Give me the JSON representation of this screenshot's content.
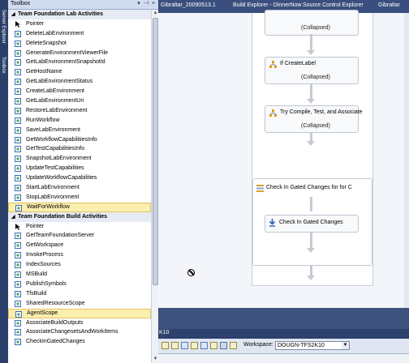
{
  "left_strip": {
    "server_explorer": "Server Explorer",
    "toolbox": "Toolbox"
  },
  "toolbox": {
    "title": "Toolbox",
    "sections": [
      {
        "title": "Team Foundation Lab Activities",
        "items": [
          "Pointer",
          "DeleteLabEnvironment",
          "DeleteSnapshot",
          "GenerateEnvironmentViewerFile",
          "GetLabEnvironmentSnapshotId",
          "GetHostName",
          "GetLabEnvironmentStatus",
          "CreateLabEnvironment",
          "GetLabEnvironmentUri",
          "RestoreLabEnvironment",
          "RunWorkflow",
          "SaveLabEnvironment",
          "GetWorkflowCapabilitiesInfo",
          "GetTestCapabilitiesInfo",
          "SnapshotLabEnvironment",
          "UpdateTestCapabilities",
          "UpdateWorkflowCapabilities",
          "StartLabEnvironment",
          "StopLabEnvironment",
          "WaitForWorkflow"
        ]
      },
      {
        "title": "Team Foundation Build Activities",
        "items": [
          "Pointer",
          "GetTeamFoundationServer",
          "GetWorkspace",
          "InvokeProcess",
          "IndexSources",
          "MSBuild",
          "PublishSymbols",
          "TfsBuild",
          "SharedResourceScope",
          "AgentScope",
          "AssociateBuildOutputs",
          "AssociateChangesetsAndWorkItems",
          "CheckInGatedChanges"
        ]
      }
    ]
  },
  "tabs": [
    "Gibraltar_20090513.1",
    "Build Explorer - DinnerNow",
    "Source Control Explorer",
    "Gibraltar"
  ],
  "designer": {
    "collapsed": "(Collapsed)",
    "activities": [
      "If CreateLabel",
      "Try Compile, Test, and Associate",
      "Check In Gated Changes for for C",
      "Check In Gated Changes"
    ]
  },
  "output_header": "K10",
  "source_bar": {
    "workspace_label": "Workspace:",
    "workspace_value": "DOUGN-TFS2K10"
  },
  "colors": {
    "selection": "#fbefae",
    "accent": "#3a4f7d",
    "panel_title": "#cfdbf0"
  }
}
